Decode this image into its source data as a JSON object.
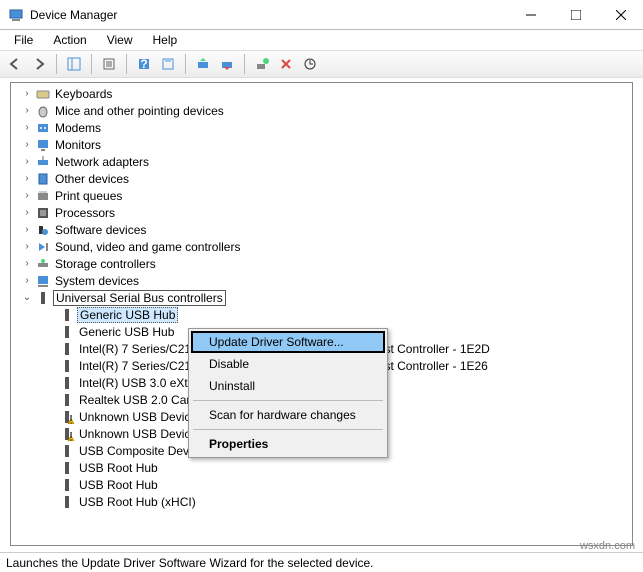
{
  "title": "Device Manager",
  "menubar": {
    "file": "File",
    "action": "Action",
    "view": "View",
    "help": "Help"
  },
  "tree": {
    "items": [
      "Keyboards",
      "Mice and other pointing devices",
      "Modems",
      "Monitors",
      "Network adapters",
      "Other devices",
      "Print queues",
      "Processors",
      "Software devices",
      "Sound, video and game controllers",
      "Storage controllers",
      "System devices",
      "Universal Serial Bus controllers"
    ],
    "usb_children": [
      "Generic USB Hub",
      "Generic USB Hub",
      "Intel(R) 7 Series/C216 Chipset Family USB Enhanced Host Controller - 1E2D",
      "Intel(R) 7 Series/C216 Chipset Family USB Enhanced Host Controller - 1E26",
      "Intel(R) USB 3.0 eXtensible Host Controller",
      "Realtek USB 2.0 Card Reader",
      "Unknown USB Device",
      "Unknown USB Device",
      "USB Composite Device",
      "USB Root Hub",
      "USB Root Hub",
      "USB Root Hub (xHCI)"
    ]
  },
  "context_menu": {
    "update": "Update Driver Software...",
    "disable": "Disable",
    "uninstall": "Uninstall",
    "scan": "Scan for hardware changes",
    "properties": "Properties"
  },
  "statusbar": "Launches the Update Driver Software Wizard for the selected device.",
  "watermark": "wsxdn.com"
}
